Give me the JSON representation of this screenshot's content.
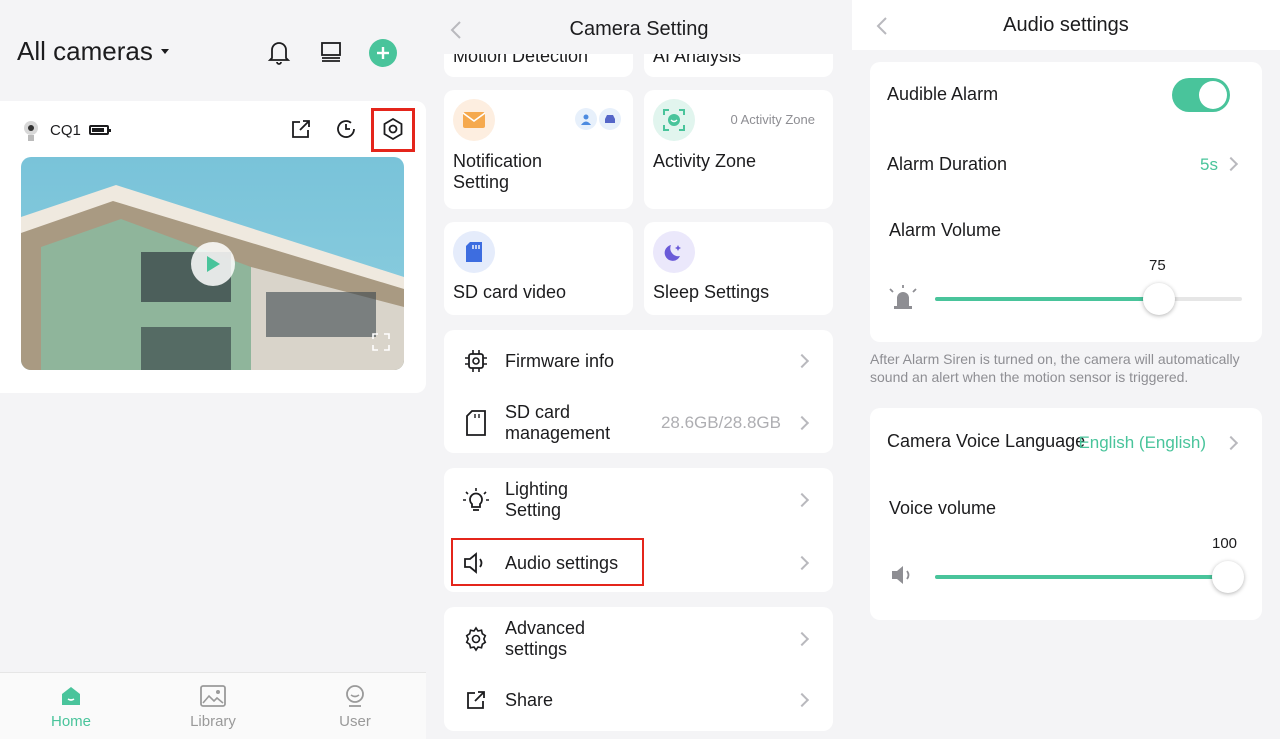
{
  "home": {
    "title": "All cameras",
    "camera_name": "CQ1",
    "nav": [
      {
        "label": "Home",
        "icon": "home-icon"
      },
      {
        "label": "Library",
        "icon": "image-icon"
      },
      {
        "label": "User",
        "icon": "user-icon"
      }
    ]
  },
  "camera_setting": {
    "title": "Camera Setting",
    "partial_left": "Motion Detection",
    "partial_right": "AI Analysis",
    "tiles": [
      {
        "label": "Notification Setting",
        "icon": "mail-icon"
      },
      {
        "label": "Activity Zone",
        "meta": "0 Activity Zone",
        "icon": "zone-icon"
      },
      {
        "label": "SD card video",
        "icon": "sd-card-icon"
      },
      {
        "label": "Sleep Settings",
        "icon": "moon-icon"
      }
    ],
    "rows": {
      "firmware": "Firmware info",
      "sd_management": "SD card management",
      "sd_value": "28.6GB/28.8GB",
      "lighting": "Lighting Setting",
      "audio": "Audio settings",
      "advanced": "Advanced settings",
      "share": "Share"
    }
  },
  "audio_settings": {
    "title": "Audio settings",
    "audible_alarm": "Audible Alarm",
    "audible_alarm_on": true,
    "alarm_duration": "Alarm Duration",
    "alarm_duration_value": "5s",
    "alarm_volume": "Alarm Volume",
    "alarm_volume_value": "75",
    "note": "After Alarm Siren is turned on, the camera will automatically sound an alert when the motion sensor is triggered.",
    "voice_language": "Camera Voice Language",
    "voice_language_value": "English (English)",
    "voice_volume": "Voice volume",
    "voice_volume_value": "100"
  },
  "colors": {
    "accent": "#49c49b",
    "highlight": "#e4251b"
  }
}
